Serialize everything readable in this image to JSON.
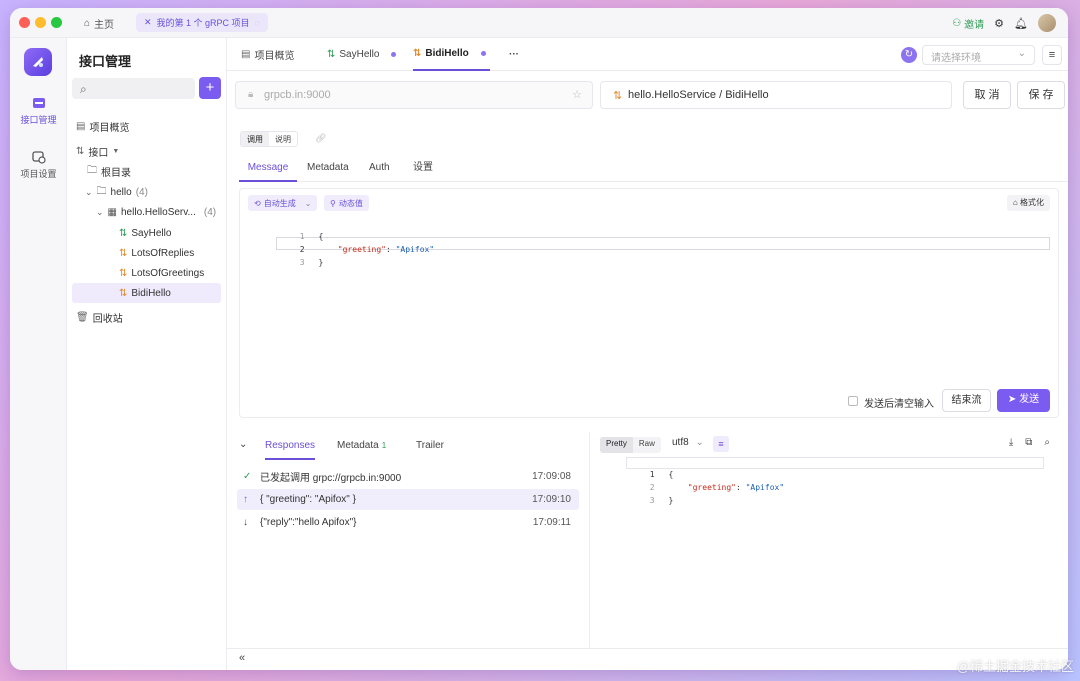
{
  "titlebar": {
    "home_label": "主页",
    "tab_label": "我的第 1 个 gRPC 项目",
    "invite_label": "邀请"
  },
  "rail": {
    "items": [
      {
        "label": "接口管理"
      },
      {
        "label": "项目设置"
      }
    ]
  },
  "tree": {
    "title": "接口管理",
    "add_label": "+",
    "nodes": [
      {
        "label": "项目概览"
      },
      {
        "label": "接口"
      },
      {
        "label": "根目录"
      },
      {
        "label": "hello",
        "count": "(4)"
      },
      {
        "label": "hello.HelloServ...",
        "count": "(4)"
      },
      {
        "label": "SayHello"
      },
      {
        "label": "LotsOfReplies"
      },
      {
        "label": "LotsOfGreetings"
      },
      {
        "label": "BidiHello"
      },
      {
        "label": "回收站"
      }
    ]
  },
  "tabs": [
    {
      "label": "项目概览"
    },
    {
      "label": "SayHello"
    },
    {
      "label": "BidiHello"
    },
    {
      "label": "···"
    }
  ],
  "env": {
    "placeholder": "请选择环境"
  },
  "request": {
    "url": "grpcb.in:9000",
    "method": "hello.HelloService / BidiHello",
    "cancel_label": "取 消",
    "save_label": "保 存",
    "mode_tabs": [
      "调用",
      "说明"
    ],
    "tabs": [
      "Message",
      "Metadata",
      "Auth",
      "设置"
    ],
    "autogen_label": "自动生成",
    "dynamic_label": "动态值",
    "format_label": "格式化",
    "code": [
      {
        "n": "1",
        "text": "{"
      },
      {
        "n": "2",
        "key": "\"greeting\"",
        "sep": ": ",
        "val": "\"Apifox\""
      },
      {
        "n": "3",
        "text": "}"
      }
    ],
    "clear_after_send_label": "发送后清空输入",
    "end_stream_label": "结束流",
    "send_label": "发送"
  },
  "response": {
    "tabs": [
      {
        "label": "Responses"
      },
      {
        "label": "Metadata",
        "badge": "1"
      },
      {
        "label": "Trailer"
      }
    ],
    "events": [
      {
        "text": "已发起调用 grpc://grpcb.in:9000",
        "time": "17:09:08"
      },
      {
        "text": "{ \"greeting\": \"Apifox\" }",
        "time": "17:09:10"
      },
      {
        "text": "{\"reply\":\"hello Apifox\"}",
        "time": "17:09:11"
      }
    ],
    "view_tabs": [
      "Pretty",
      "Raw"
    ],
    "encoding": "utf8",
    "code": [
      {
        "n": "1",
        "text": "{"
      },
      {
        "n": "2",
        "key": "\"greeting\"",
        "sep": ": ",
        "val": "\"Apifox\""
      },
      {
        "n": "3",
        "text": "}"
      }
    ]
  },
  "footer": {
    "collapse_label": "«",
    "watermark": "@稀土掘金技术社区"
  },
  "colors": {
    "accent": "#7b5cf0",
    "success": "#2e9d56",
    "method": "#e08a2e"
  }
}
